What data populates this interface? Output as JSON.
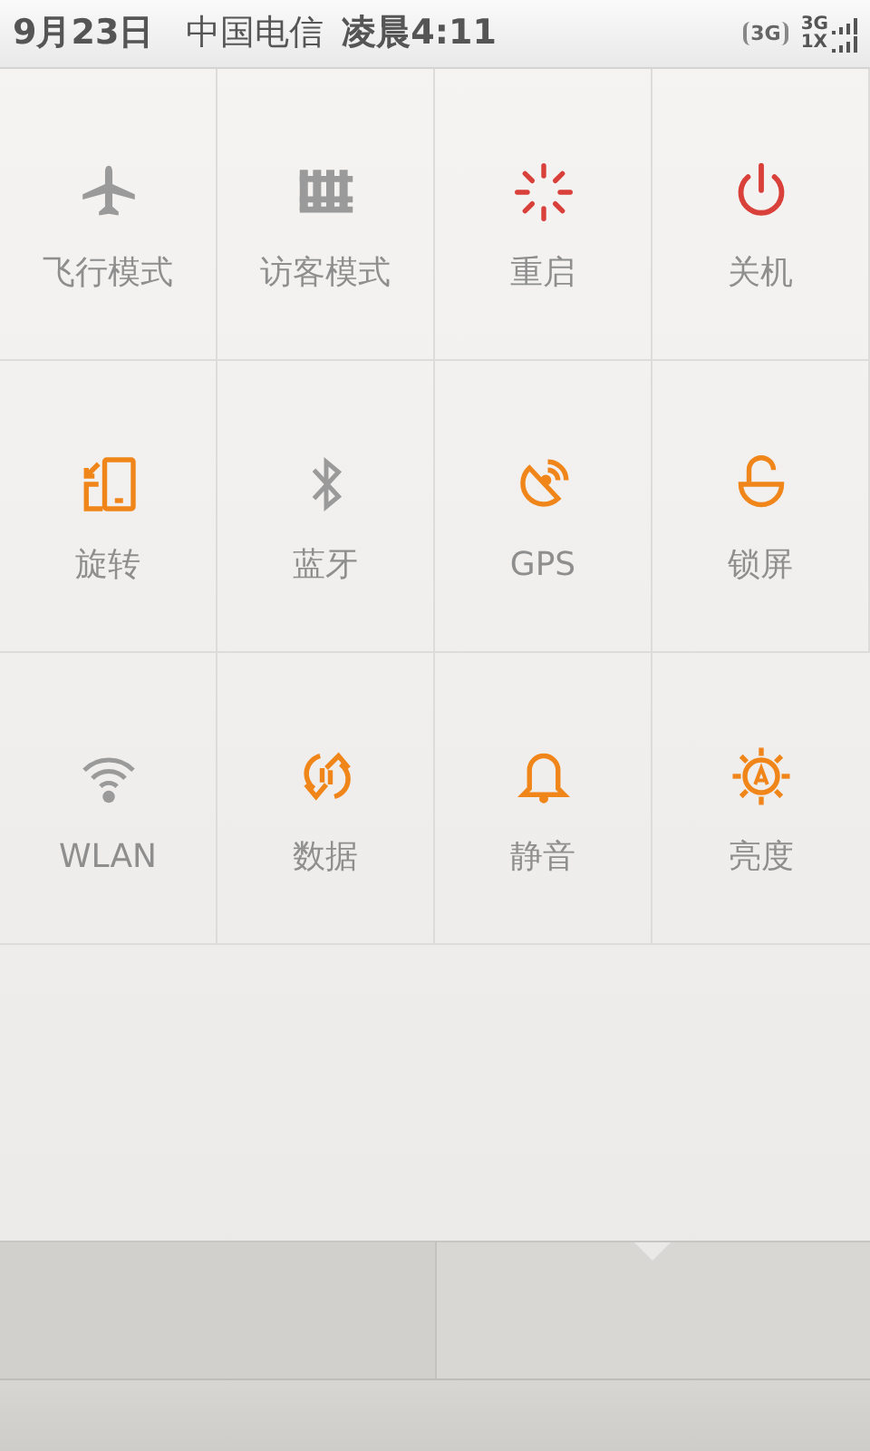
{
  "status_bar": {
    "date": "9月23日",
    "carrier": "中国电信",
    "time": "凌晨4:11",
    "data_badge": "3G",
    "signal_1": "3G",
    "signal_2": "1X"
  },
  "toggles": [
    {
      "label": "飞行模式",
      "kind": "toggle",
      "on": false
    },
    {
      "label": "访客模式",
      "kind": "toggle",
      "on": false
    },
    {
      "label": "重启",
      "kind": "action"
    },
    {
      "label": "关机",
      "kind": "action"
    },
    {
      "label": "旋转",
      "kind": "toggle",
      "on": true
    },
    {
      "label": "蓝牙",
      "kind": "toggle",
      "on": false
    },
    {
      "label": "GPS",
      "kind": "toggle",
      "on": true
    },
    {
      "label": "锁屏",
      "kind": "toggle",
      "on": true
    },
    {
      "label": "WLAN",
      "kind": "toggle",
      "on": false
    },
    {
      "label": "数据",
      "kind": "toggle",
      "on": true
    },
    {
      "label": "静音",
      "kind": "toggle",
      "on": true
    },
    {
      "label": "亮度",
      "kind": "toggle",
      "on": true
    }
  ],
  "tabs": [
    {
      "selected": false
    },
    {
      "selected": true
    }
  ]
}
